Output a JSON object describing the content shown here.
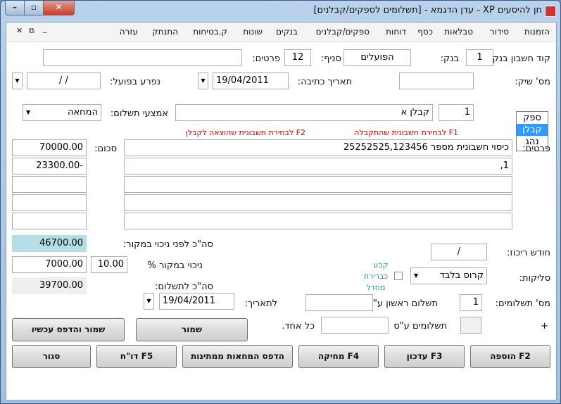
{
  "window": {
    "title": "חן להיסעים XP - עדן הדגמא - [תשלומים לספקים/קבלנים]",
    "min_symbol": "–",
    "max_symbol": "▫",
    "close_symbol": "✕"
  },
  "menu": {
    "items": [
      "הזמנות",
      "סידור",
      "טבלאות",
      "כסף",
      "דוחות",
      "ספקים/קבלנים",
      "בנקים",
      "שונות",
      "ק.בטיחות",
      "התנתק",
      "עזרה"
    ],
    "mdi_close": "✕",
    "mdi_restore": "⧉",
    "mdi_min": "_"
  },
  "form": {
    "bank_account_label": "קוד חשבון בנק:",
    "bank_account_value": "1",
    "bank_label": "בנק:",
    "bank_value": "הפועלים",
    "branch_label": "סניף:",
    "branch_value": "12",
    "details_top_label": "פרטים:",
    "details_top_value": "",
    "check_no_label": "מס' שיק:",
    "check_no_value": "",
    "write_date_label": "תאריך כתיבה:",
    "write_date_value": "19/04/2011",
    "actual_paid_label": "נפרע בפועל:",
    "actual_paid_value": "/   /",
    "vendor_types": [
      "ספק",
      "קבלן",
      "נהג"
    ],
    "vendor_selected_index": 1,
    "contractor_code": "1",
    "contractor_name": "קבלן א",
    "payment_method_label": "אמצעי תשלום:",
    "payment_method_value": "המחאה",
    "hint_f1": "F1 לבחירת חשבונית שהתקבלה",
    "hint_f2": "F2 לבחירת חשבונית שהוצאה לקבלן",
    "details_label": "פרטים:",
    "amount_label": "סכום:",
    "lines": [
      {
        "detail": "כיסוי חשבונית מספר 25252525,123456",
        "amount": "70000.00"
      },
      {
        "detail": "1,",
        "amount": "23300.00-"
      },
      {
        "detail": "",
        "amount": ""
      },
      {
        "detail": "",
        "amount": ""
      },
      {
        "detail": "",
        "amount": ""
      }
    ],
    "total_before_label": "סה\"כ לפני ניכוי במקור:",
    "total_before_value": "46700.00",
    "withholding_label": "ניכוי במקור %",
    "withholding_pct": "10.00",
    "withholding_value": "7000.00",
    "total_pay_label": "סה\"כ לתשלום:",
    "total_pay_value": "39700.00",
    "consolidation_month_label": "חודש ריכוז:",
    "consolidation_month_value": "/",
    "clearing_label": "סליקות:",
    "clearing_value": "קרוס בלבד",
    "default_label_1": "קבע",
    "default_label_2": "כברירת",
    "default_label_3": "מחדל",
    "installments_label": "מס' תשלומים:",
    "installments_value": "1",
    "first_payment_label": "תשלום ראשון ע\"ס:",
    "first_payment_value": "",
    "to_date_label": "לתאריך:",
    "to_date_value": "19/04/2011",
    "payments_label": "תשלומים ע\"ס",
    "each_label": "כל אחד.",
    "payments_value": "",
    "plus_label": "+"
  },
  "buttons": {
    "save": "שמור",
    "save_print": "שמור והדפס עכשיו",
    "add": "הוספה F2",
    "update": "עדכון F3",
    "delete": "מחיקה F4",
    "print_checks": "הדפס המחאות ממתינות",
    "report": "דו\"ח F5",
    "close": "סגור"
  }
}
